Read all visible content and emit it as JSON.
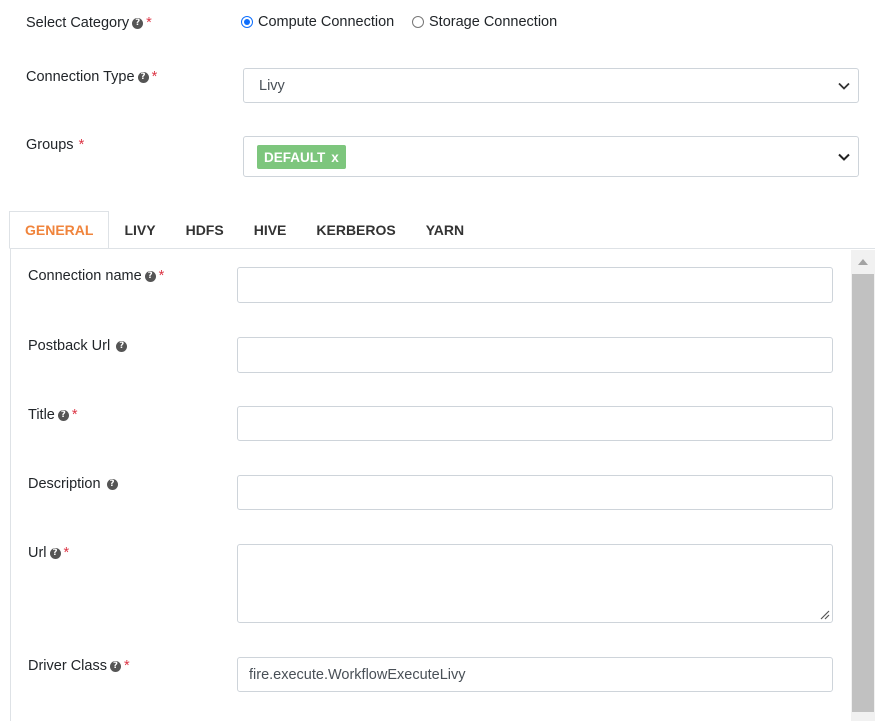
{
  "category": {
    "label": "Select Category",
    "options": [
      {
        "label": "Compute Connection",
        "selected": true
      },
      {
        "label": "Storage Connection",
        "selected": false
      }
    ]
  },
  "connection_type": {
    "label": "Connection Type",
    "value": "Livy"
  },
  "groups": {
    "label": "Groups",
    "tags": [
      {
        "label": "DEFAULT",
        "remove": "x"
      }
    ]
  },
  "tabs": [
    {
      "label": "GENERAL",
      "active": true
    },
    {
      "label": "LIVY"
    },
    {
      "label": "HDFS"
    },
    {
      "label": "HIVE"
    },
    {
      "label": "KERBEROS"
    },
    {
      "label": "YARN"
    }
  ],
  "fields": {
    "connection_name": {
      "label": "Connection name",
      "value": ""
    },
    "postback_url": {
      "label": "Postback Url",
      "value": ""
    },
    "title": {
      "label": "Title",
      "value": ""
    },
    "description": {
      "label": "Description",
      "value": ""
    },
    "url": {
      "label": "Url",
      "value": ""
    },
    "driver_class": {
      "label": "Driver Class",
      "value": "fire.execute.WorkflowExecuteLivy"
    }
  },
  "symbols": {
    "help": "?",
    "required": "*"
  },
  "colors": {
    "accent_tab": "#f0843c",
    "tag_bg": "#7dc67d",
    "radio_on": "#0d6efd",
    "required": "#dc3545"
  }
}
